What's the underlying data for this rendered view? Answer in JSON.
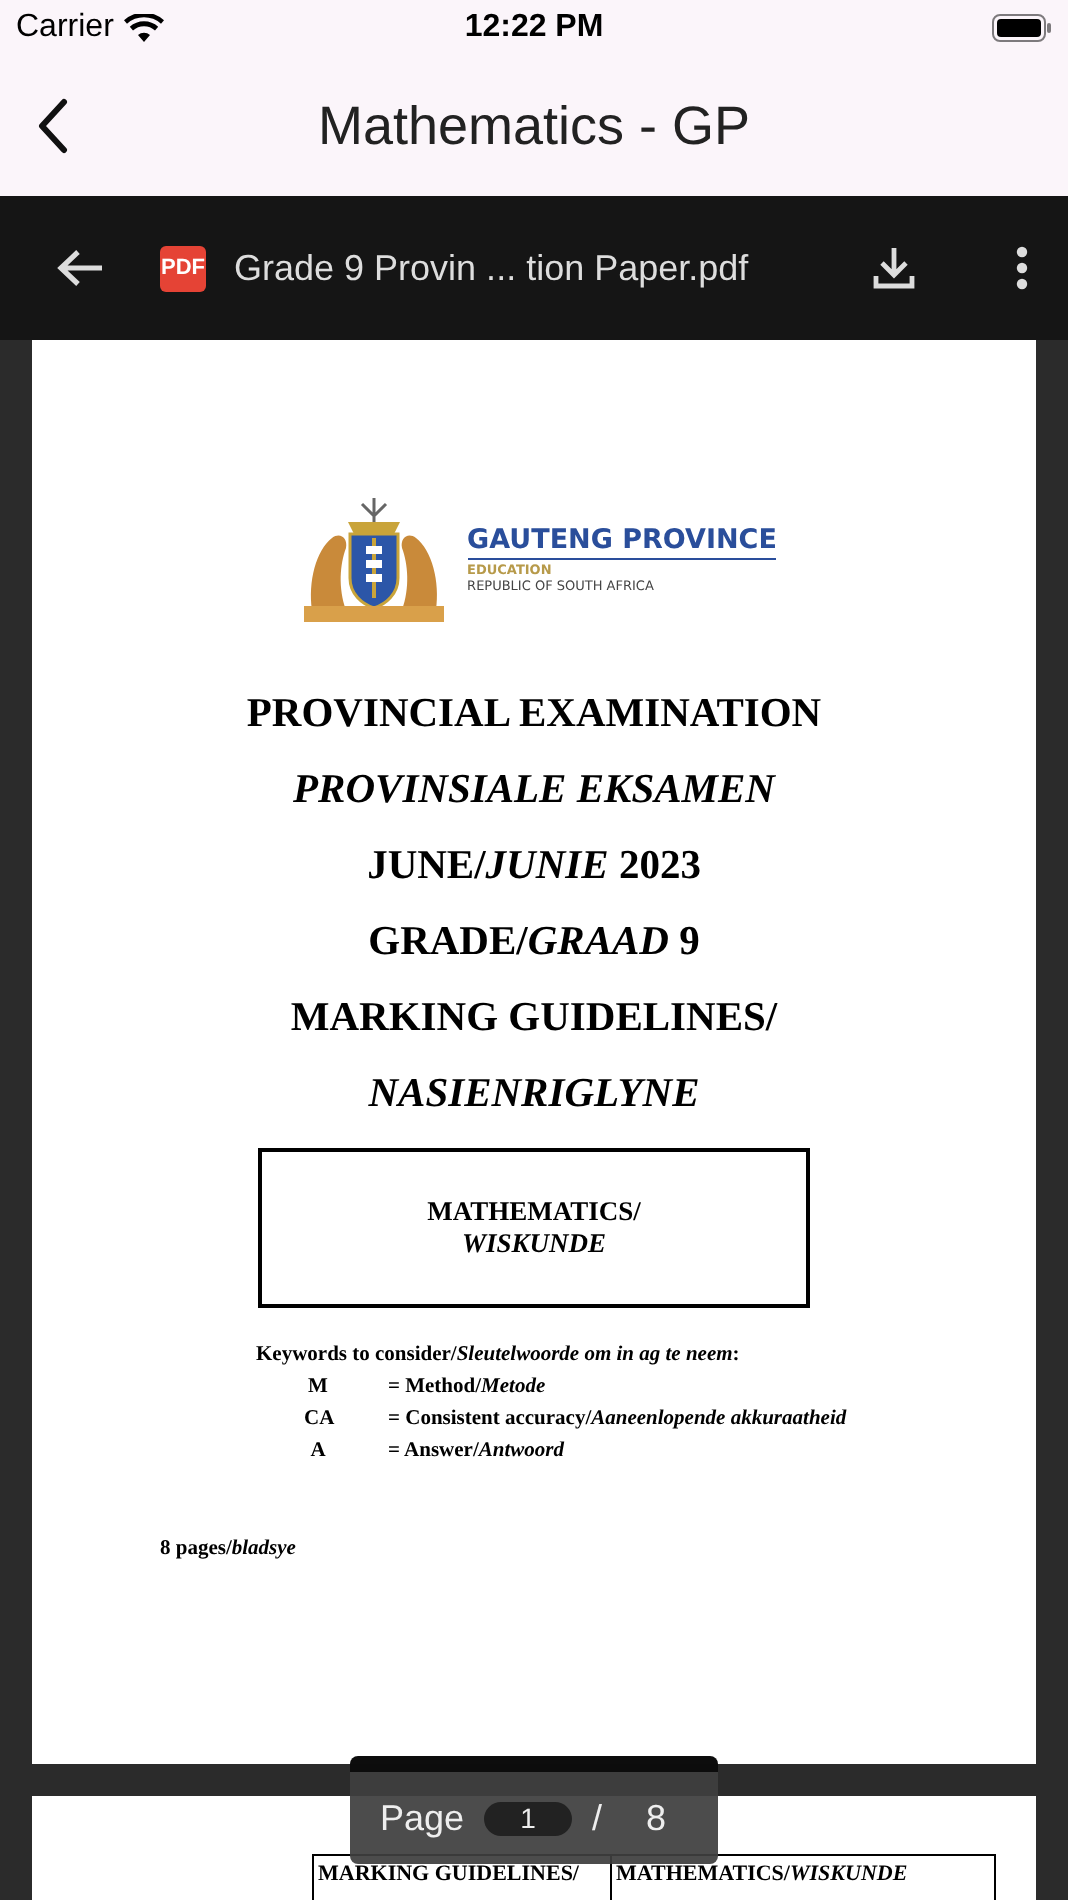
{
  "status_bar": {
    "carrier": "Carrier",
    "time": "12:22 PM"
  },
  "nav_bar": {
    "title": "Mathematics - GP"
  },
  "viewer_toolbar": {
    "file_badge": "PDF",
    "file_name": "Grade 9 Provin ... tion Paper.pdf"
  },
  "document": {
    "pages": [
      {
        "kind": "cover",
        "logo": {
          "title": "GAUTENG PROVINCE",
          "subtitle": "EDUCATION",
          "country": "REPUBLIC OF SOUTH AFRICA"
        },
        "headings": [
          {
            "text": "PROVINCIAL EXAMINATION",
            "kind": "plain"
          },
          {
            "text": "PROVINSIALE EKSAMEN",
            "kind": "italic"
          },
          {
            "text": "JUNE/*JUNIE* 2023",
            "kind": "plain"
          },
          {
            "text": "GRADE/*GRAAD* 9",
            "kind": "plain"
          },
          {
            "text": "MARKING GUIDELINES/",
            "kind": "plain"
          },
          {
            "text": "NASIENRIGLYNE",
            "kind": "italic"
          }
        ],
        "subject_box": [
          {
            "text": "MATHEMATICS/",
            "kind": "plain"
          },
          {
            "text": "WISKUNDE",
            "kind": "italic"
          }
        ],
        "keywords_intro": "Keywords to consider/*Sleutelwoorde om in ag te neem*:",
        "keywords": [
          {
            "abbr": "M",
            "meaning": "=  Method/*Metode*"
          },
          {
            "abbr": "CA",
            "meaning": "= Consistent accuracy/*Aaneenlopende akkuraatheid*"
          },
          {
            "abbr": "A",
            "meaning": "= Answer/*Antwoord*"
          }
        ],
        "page_count": "8 pages/*bladsye*"
      },
      {
        "kind": "header",
        "header_cells": [
          "MARKING GUIDELINES/",
          "MATHEMATICS/*WISKUNDE*"
        ]
      }
    ]
  },
  "page_indicator": {
    "label": "Page",
    "current": "1",
    "separator": "/",
    "total": "8"
  }
}
